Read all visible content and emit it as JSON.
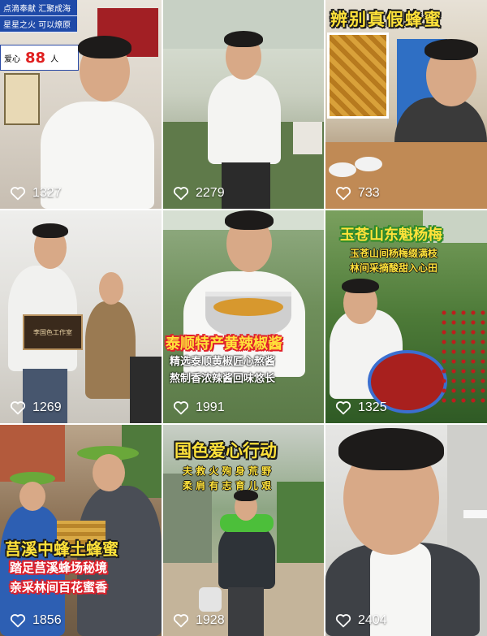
{
  "videos": [
    {
      "likes": "1327",
      "sign_lines": [
        "点滴奉献 汇聚成海",
        "星星之火 可以燎原"
      ],
      "counter_label": "爱心",
      "counter_sub": "已进",
      "counter_value": "88",
      "counter_unit": "人"
    },
    {
      "likes": "2279"
    },
    {
      "likes": "733",
      "title": "辨别真假蜂蜜"
    },
    {
      "likes": "1269",
      "plaque_text": "李国色工作室"
    },
    {
      "likes": "1991",
      "title": "泰顺特产黄辣椒酱",
      "lines": [
        "精选泰顺黄椒匠心熬酱",
        "熬制香浓辣酱回味悠长"
      ]
    },
    {
      "likes": "1325",
      "title": "玉苍山东魁杨梅",
      "lines": [
        "玉苍山间杨梅缀满枝",
        "林间采摘酸甜入心田"
      ]
    },
    {
      "likes": "1856",
      "title": "莒溪中蜂土蜂蜜",
      "lines": [
        "踏足莒溪蜂场秘境",
        "亲采林间百花蜜香"
      ]
    },
    {
      "likes": "1928",
      "title": "国色爱心行动",
      "lines": [
        "夫 救 火 殉 身 荒 野",
        "柔 肩 有 志 育 儿 艰"
      ]
    },
    {
      "likes": "2404"
    }
  ],
  "colors": {
    "caption_yellow": "#ffe23a",
    "caption_red_outline": "#e0202a",
    "like_text": "#ffffff"
  },
  "icons": {
    "like": "heart-outline-icon"
  }
}
